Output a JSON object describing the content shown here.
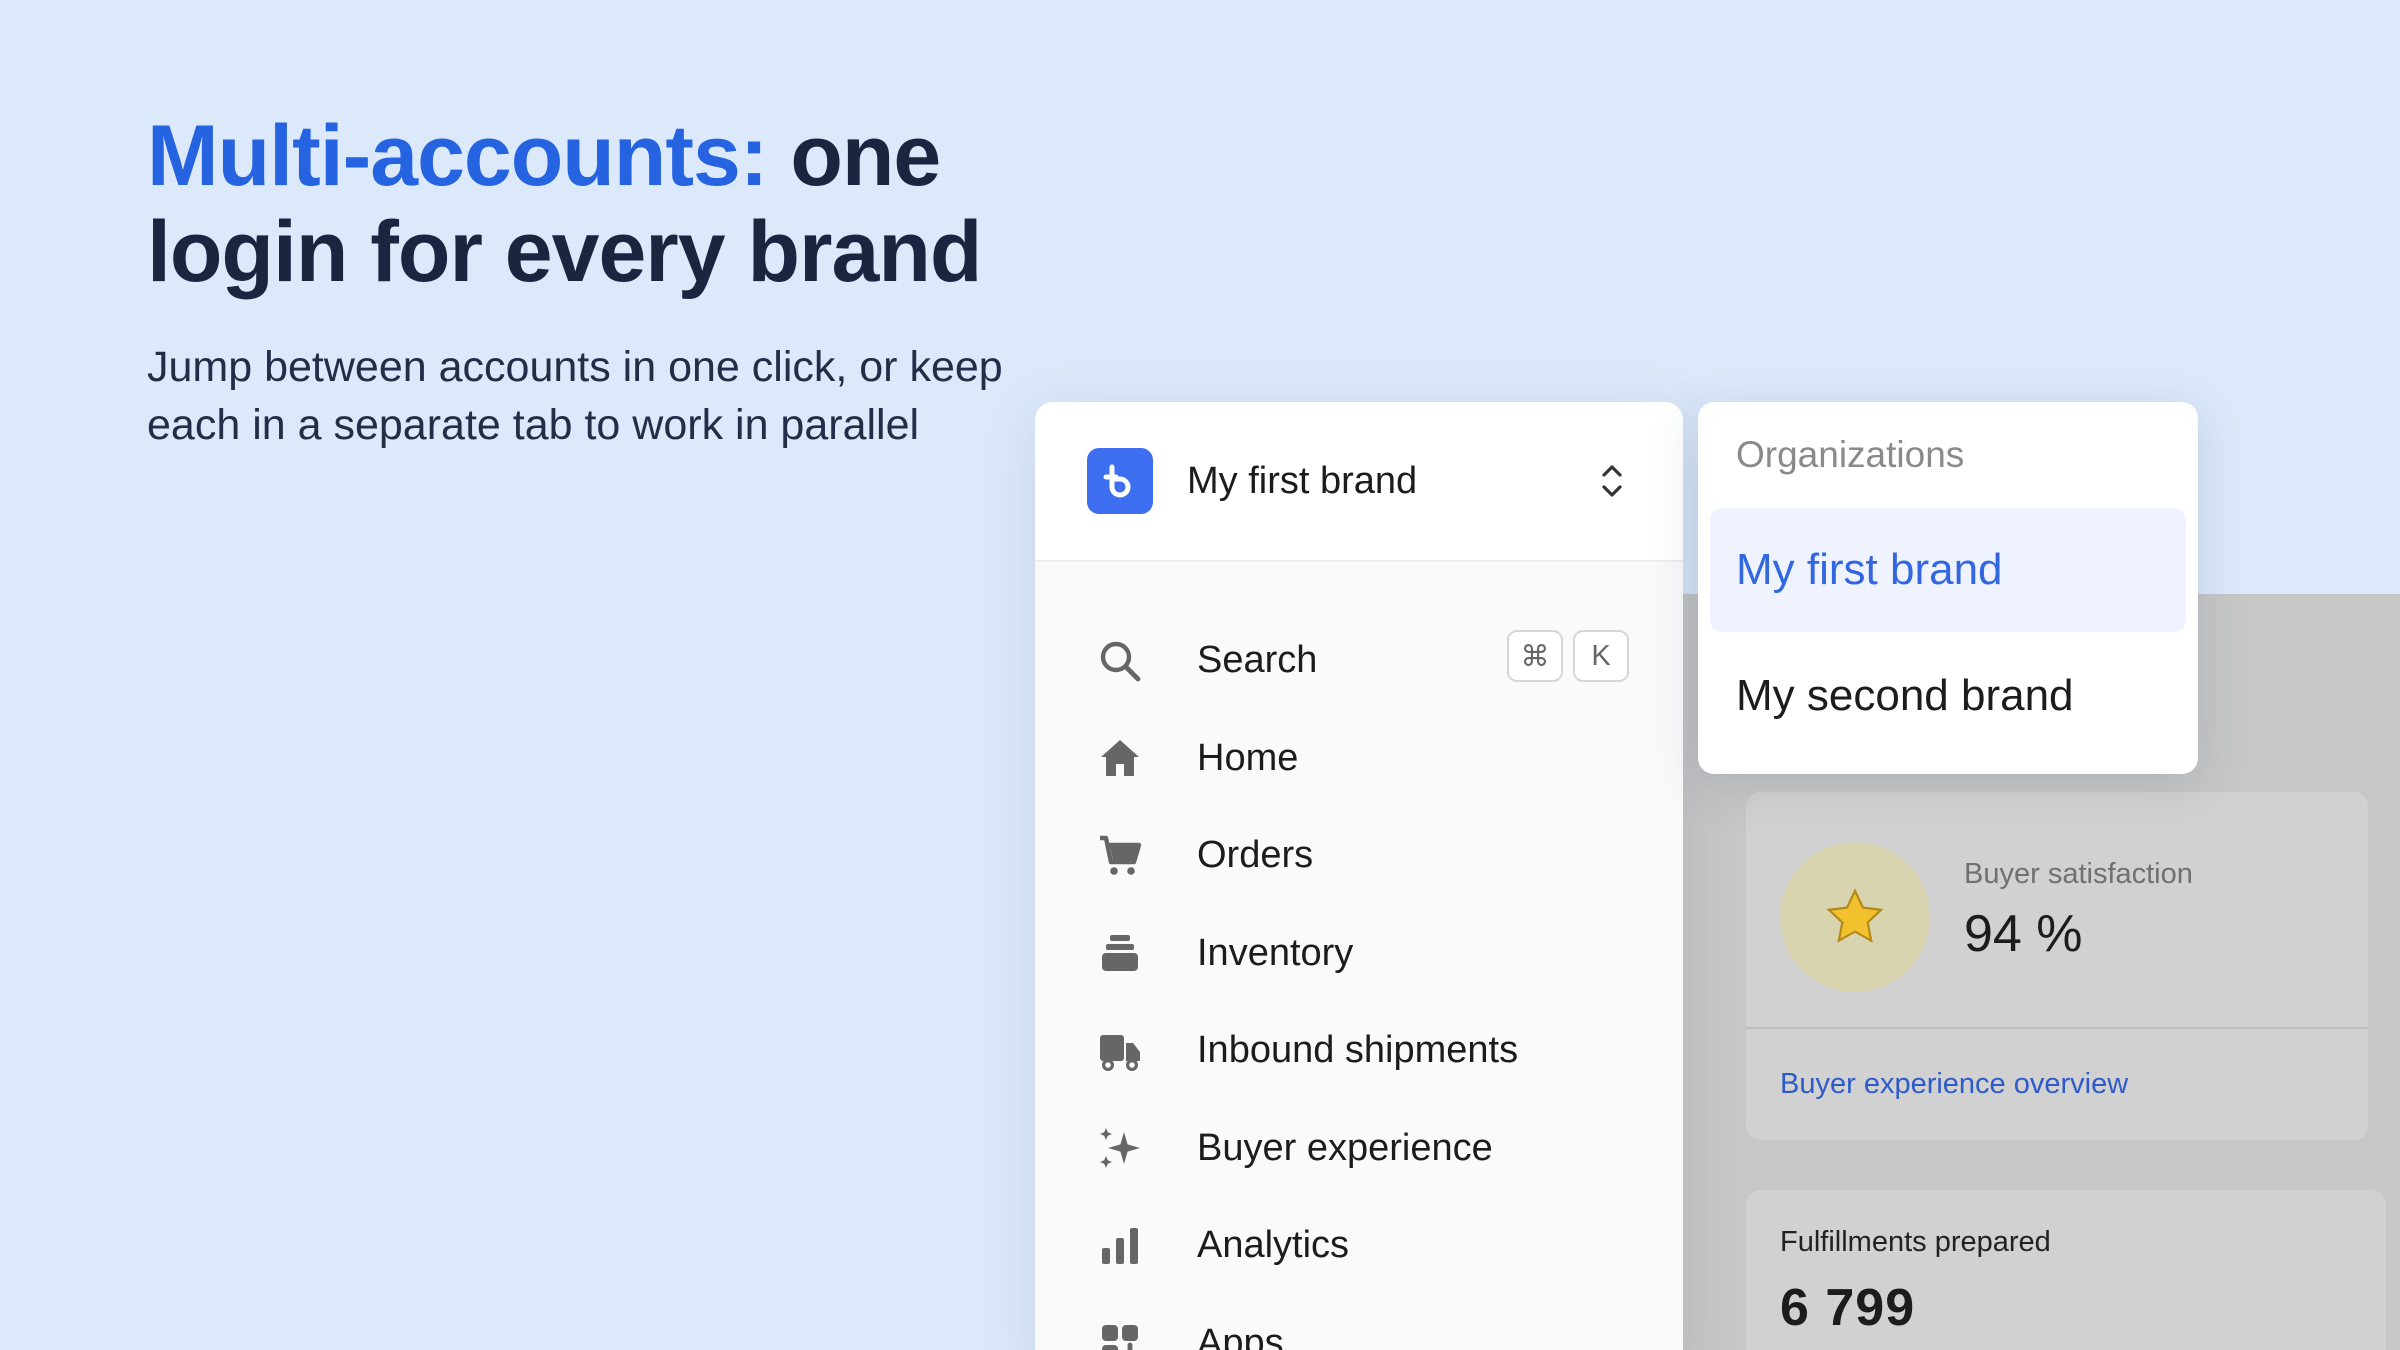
{
  "hero": {
    "headline_accent": "Multi-accounts:",
    "headline_rest_line1": " one",
    "headline_line2": "login for every brand",
    "subtext": "Jump between accounts in one click, or keep each in a separate tab to work in parallel"
  },
  "sidebar": {
    "brand": {
      "name": "My first brand",
      "logo_icon": "brand-logo-icon",
      "switch_icon": "chevron-up-down-icon"
    },
    "search_shortcut": [
      "⌘",
      "K"
    ],
    "items": [
      {
        "label": "Search",
        "icon": "search-icon"
      },
      {
        "label": "Home",
        "icon": "home-icon"
      },
      {
        "label": "Orders",
        "icon": "cart-icon"
      },
      {
        "label": "Inventory",
        "icon": "inventory-icon"
      },
      {
        "label": "Inbound shipments",
        "icon": "truck-icon"
      },
      {
        "label": "Buyer experience",
        "icon": "sparkles-icon"
      },
      {
        "label": "Analytics",
        "icon": "bar-chart-icon"
      },
      {
        "label": "Apps",
        "icon": "apps-icon"
      }
    ]
  },
  "organizations": {
    "title": "Organizations",
    "items": [
      {
        "label": "My first brand",
        "selected": true
      },
      {
        "label": "My second brand",
        "selected": false
      }
    ]
  },
  "dashboard": {
    "satisfaction": {
      "label": "Buyer satisfaction",
      "value": "94 %",
      "icon": "star-icon",
      "link": "Buyer experience overview"
    },
    "fulfillments": {
      "label": "Fulfillments prepared",
      "value": "6 799"
    }
  },
  "colors": {
    "background": "#dce9fb",
    "accent": "#2563e0",
    "brand_logo": "#3d6ff0",
    "selected_bg": "#eef3ff",
    "overlay_grey": "#c7c7c7"
  }
}
